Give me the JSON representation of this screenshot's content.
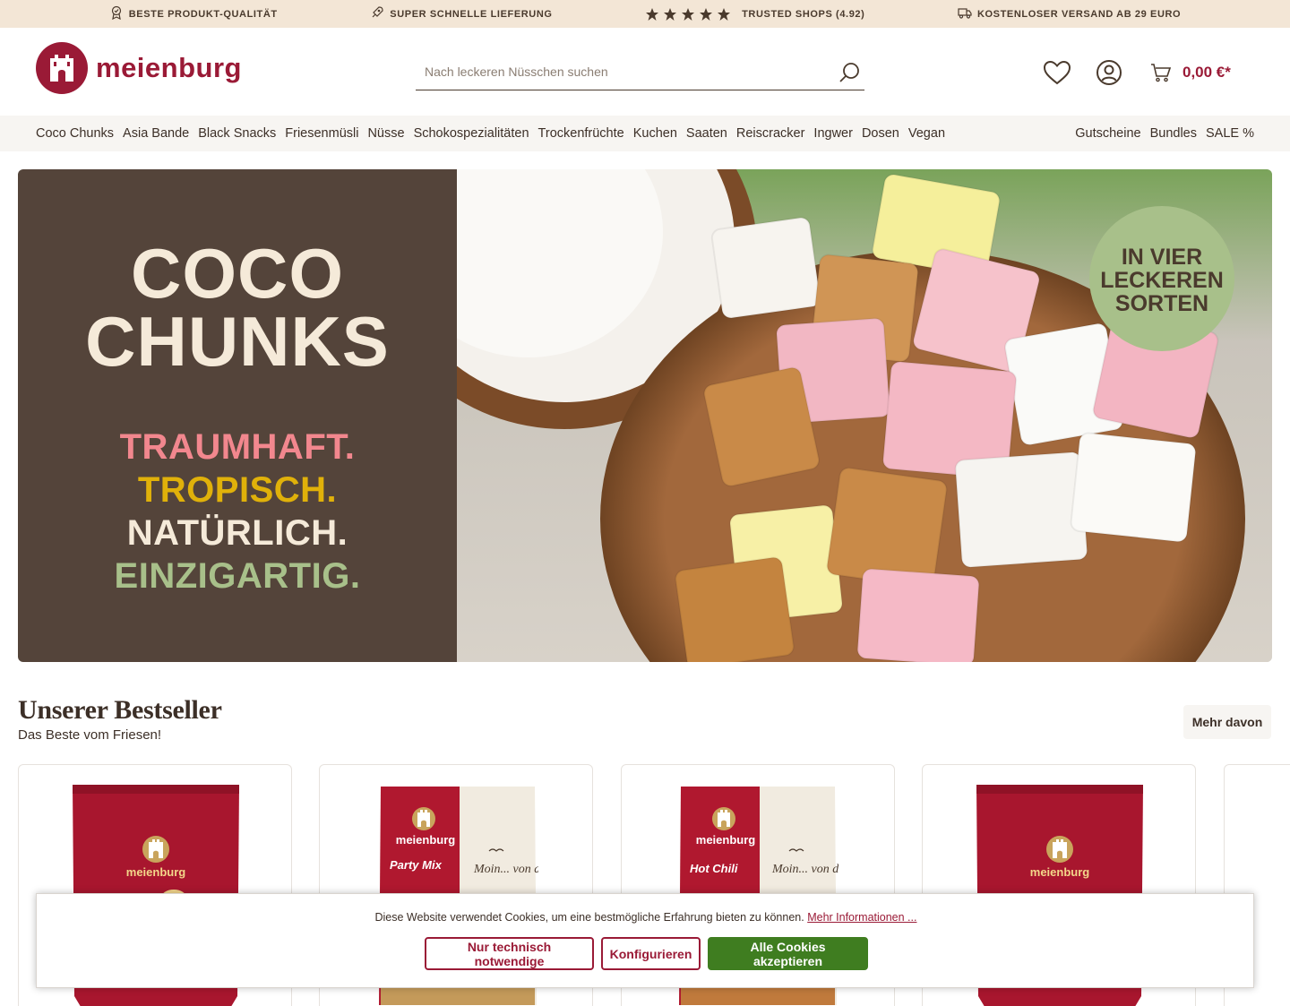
{
  "topbar": {
    "usps": [
      {
        "icon": "quality-badge-icon",
        "label": "BESTE PRODUKT-QUALITÄT"
      },
      {
        "icon": "rocket-icon",
        "label": "SUPER SCHNELLE LIEFERUNG"
      },
      {
        "icon": "star-icon",
        "label": "TRUSTED SHOPS (4.92)",
        "stars": 5
      },
      {
        "icon": "delivery-truck-icon",
        "label": "KOSTENLOSER VERSAND AB 29 EURO"
      }
    ]
  },
  "header": {
    "logo_text": "meienburg",
    "search_placeholder": "Nach leckeren Nüsschen suchen",
    "cart_total": "0,00 €*"
  },
  "nav": {
    "left": [
      "Coco Chunks",
      "Asia Bande",
      "Black Snacks",
      "Friesenmüsli",
      "Nüsse",
      "Schokospezialitäten",
      "Trockenfrüchte",
      "Kuchen",
      "Saaten",
      "Reiscracker",
      "Ingwer",
      "Dosen",
      "Vegan"
    ],
    "right": [
      "Gutscheine",
      "Bundles",
      "SALE %"
    ]
  },
  "hero": {
    "title_line1": "COCO",
    "title_line2": "CHUNKS",
    "line1": "TRAUMHAFT.",
    "line2": "TROPISCH.",
    "line3": "NATÜRLICH.",
    "line4": "EINZIGARTIG.",
    "badge_line1": "IN VIER",
    "badge_line2": "LECKEREN",
    "badge_line3": "SORTEN"
  },
  "bestseller": {
    "title": "Unserer Bestseller",
    "subtitle": "Das Beste vom Friesen!",
    "more_label": "Mehr davon",
    "products": [
      {
        "brand": "meienburg",
        "variant": ""
      },
      {
        "brand": "meienburg",
        "variant": "Party Mix",
        "window_text": "Moin... von der"
      },
      {
        "brand": "meienburg",
        "variant": "Hot Chili",
        "window_text": "Moin... von der"
      },
      {
        "brand": "meienburg",
        "variant": ""
      }
    ]
  },
  "cookie": {
    "text": "Diese Website verwendet Cookies, um eine bestmögliche Erfahrung bieten zu können.",
    "link": "Mehr Informationen ...",
    "btn_necessary": "Nur technisch notwendige",
    "btn_configure": "Konfigurieren",
    "btn_accept": "Alle Cookies akzeptieren"
  },
  "colors": {
    "brand": "#9a1a36",
    "topbar_bg": "#f3e6d6",
    "hero_left_bg": "#54443a",
    "accept_green": "#3f7d20"
  }
}
